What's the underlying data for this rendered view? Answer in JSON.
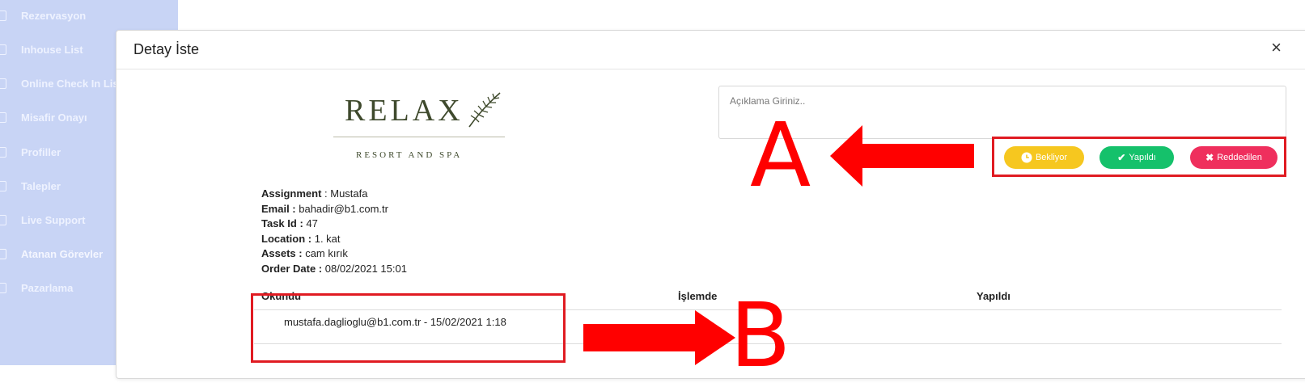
{
  "sidebar": {
    "items": [
      {
        "label": "Rezervasyon"
      },
      {
        "label": "Inhouse List"
      },
      {
        "label": "Online Check In List"
      },
      {
        "label": "Misafir Onayı"
      },
      {
        "label": "Profiller"
      },
      {
        "label": "Talepler"
      },
      {
        "label": "Live Support"
      },
      {
        "label": "Atanan Görevler",
        "active": true
      },
      {
        "label": "Pazarlama"
      }
    ]
  },
  "modal": {
    "title": "Detay İste",
    "close_icon": "×"
  },
  "logo": {
    "brand": "RELAX",
    "tagline": "RESORT AND SPA"
  },
  "description": {
    "placeholder": "Açıklama Giriniz.."
  },
  "status_buttons": {
    "waiting": {
      "label": "Bekliyor",
      "icon": "clock-icon",
      "color": "#f6c71f"
    },
    "done": {
      "label": "Yapıldı",
      "icon": "check-icon",
      "color": "#15c16b"
    },
    "rejected": {
      "label": "Reddedilen",
      "icon": "x-icon",
      "color": "#ef2f5d"
    }
  },
  "details": {
    "assignment_label": "Assignment",
    "assignment_value": " : Mustafa",
    "email_label": "Email :",
    "email_value": " bahadir@b1.com.tr",
    "task_label": "Task Id :",
    "task_value": " 47",
    "location_label": "Location :",
    "location_value": " 1. kat",
    "assets_label": "Assets :",
    "assets_value": " cam kırık",
    "order_label": "Order Date :",
    "order_value": " 08/02/2021 15:01"
  },
  "table": {
    "headers": [
      "Okundu",
      "İşlemde",
      "Yapıldı"
    ],
    "rows": [
      {
        "okundu": "mustafa.daglioglu@b1.com.tr - 15/02/2021 1:18",
        "islemde": "",
        "yapildi": ""
      }
    ]
  },
  "annotations": {
    "a_letter": "A",
    "b_letter": "B",
    "color": "#ff0000"
  }
}
